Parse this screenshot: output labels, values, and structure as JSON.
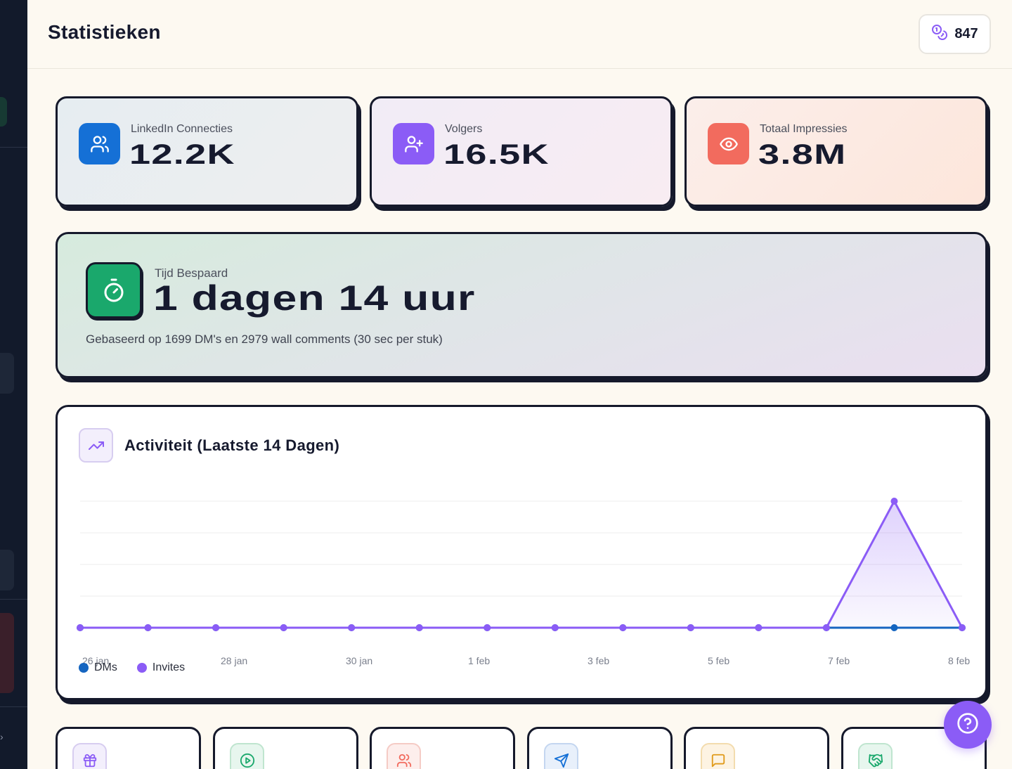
{
  "header": {
    "title": "Statistieken",
    "credits": "847",
    "credits_icon": "coins-icon"
  },
  "stats": [
    {
      "label": "LinkedIn Connecties",
      "value": "12.2K",
      "icon": "users-icon",
      "color": "#1570d6"
    },
    {
      "label": "Volgers",
      "value": "16.5K",
      "icon": "user-plus-icon",
      "color": "#8b5cf6"
    },
    {
      "label": "Totaal Impressies",
      "value": "3.8M",
      "icon": "eye-icon",
      "color": "#f26b5e"
    }
  ],
  "time_saved": {
    "label": "Tijd Bespaard",
    "value": "1 dagen 14 uur",
    "note": "Gebaseerd op 1699 DM's en 2979 wall comments (30 sec per stuk)",
    "icon": "stopwatch-icon",
    "color": "#1aa86c"
  },
  "activity": {
    "title": "Activiteit (Laatste 14 Dagen)",
    "icon": "trending-up-icon"
  },
  "chart_data": {
    "type": "area",
    "title": "Activiteit (Laatste 14 Dagen)",
    "x": [
      "26 jan",
      "27 jan",
      "28 jan",
      "29 jan",
      "30 jan",
      "31 jan",
      "1 feb",
      "2 feb",
      "3 feb",
      "4 feb",
      "5 feb",
      "6 feb",
      "7 feb",
      "8 feb"
    ],
    "tick_labels": [
      "26 jan",
      "28 jan",
      "30 jan",
      "1 feb",
      "3 feb",
      "5 feb",
      "7 feb",
      "8 feb"
    ],
    "series": [
      {
        "name": "DMs",
        "color": "#1565c0",
        "values": [
          0,
          0,
          0,
          0,
          0,
          0,
          0,
          0,
          0,
          0,
          0,
          0,
          0,
          0
        ]
      },
      {
        "name": "Invites",
        "color": "#8b5cf6",
        "values": [
          0,
          0,
          0,
          0,
          0,
          0,
          0,
          0,
          0,
          0,
          0,
          0,
          1,
          0
        ]
      }
    ],
    "ylim": [
      0,
      1
    ],
    "grid": true,
    "legend": "bottom-left"
  },
  "shortcuts": [
    {
      "icon": "gift-icon",
      "color": "#8b5cf6",
      "bg": "#f3effc"
    },
    {
      "icon": "play-circle-icon",
      "color": "#1aa86c",
      "bg": "#e7f6ee"
    },
    {
      "icon": "users-icon",
      "color": "#f26b5e",
      "bg": "#fdeeec"
    },
    {
      "icon": "send-icon",
      "color": "#1570d6",
      "bg": "#e8f0fb"
    },
    {
      "icon": "message-square-icon",
      "color": "#e09a1a",
      "bg": "#fdf3e2"
    },
    {
      "icon": "handshake-icon",
      "color": "#1aa86c",
      "bg": "#e7f6ee"
    }
  ],
  "help": {
    "icon": "help-circle-icon"
  }
}
